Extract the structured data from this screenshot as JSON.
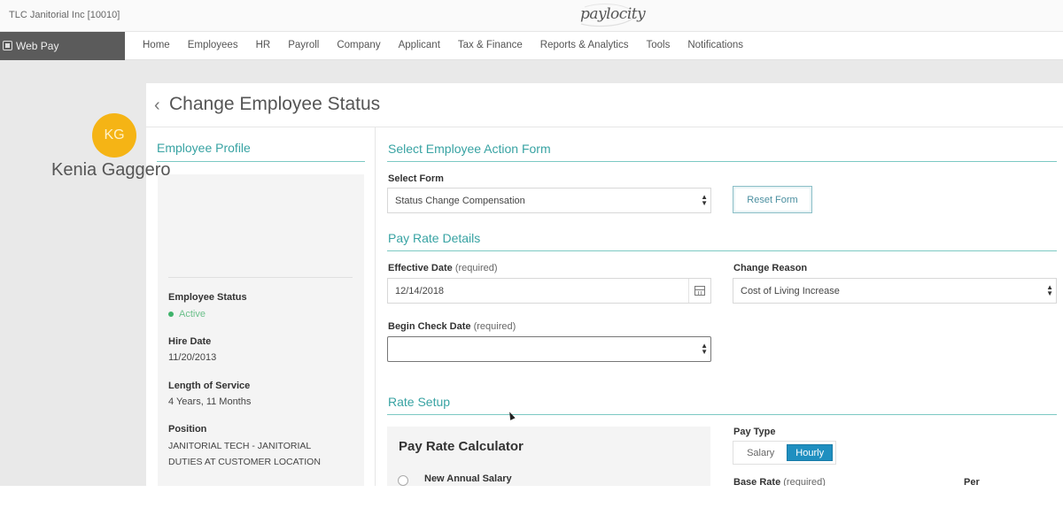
{
  "header": {
    "company": "TLC Janitorial Inc [10010]",
    "logo_text": "paylocity"
  },
  "nav": {
    "webpay_label": "Web Pay",
    "items": [
      "Home",
      "Employees",
      "HR",
      "Payroll",
      "Company",
      "Applicant",
      "Tax & Finance",
      "Reports & Analytics",
      "Tools",
      "Notifications"
    ]
  },
  "page": {
    "title": "Change Employee Status"
  },
  "profile": {
    "section_title": "Employee Profile",
    "initials": "KG",
    "name": "Kenia Gaggero",
    "avatar_color": "#f5b415",
    "status_label": "Employee Status",
    "status_value": "Active",
    "hire_label": "Hire Date",
    "hire_value": "11/20/2013",
    "service_label": "Length of Service",
    "service_value": "4 Years, 11 Months",
    "position_label": "Position",
    "position_line1": "JANITORIAL TECH - JANITORIAL",
    "position_line2": "DUTIES AT CUSTOMER LOCATION"
  },
  "action_form": {
    "section_title": "Select Employee Action Form",
    "select_label": "Select Form",
    "select_value": "Status Change Compensation",
    "reset_label": "Reset Form"
  },
  "pay_rate": {
    "section_title": "Pay Rate Details",
    "effective_label": "Effective Date",
    "required_text": "(required)",
    "effective_value": "12/14/2018",
    "reason_label": "Change Reason",
    "reason_value": "Cost of Living Increase",
    "begin_check_label": "Begin Check Date",
    "begin_check_value": ""
  },
  "rate_setup": {
    "section_title": "Rate Setup",
    "calculator_title": "Pay Rate Calculator",
    "new_salary_label": "New Annual Salary",
    "pay_type_label": "Pay Type",
    "pay_type_options": [
      "Salary",
      "Hourly"
    ],
    "pay_type_selected": "Hourly",
    "base_rate_label": "Base Rate",
    "per_label": "Per"
  },
  "colors": {
    "accent_teal": "#38a3a3",
    "selected_blue": "#1f8fc0",
    "active_green": "#3fb36b"
  }
}
